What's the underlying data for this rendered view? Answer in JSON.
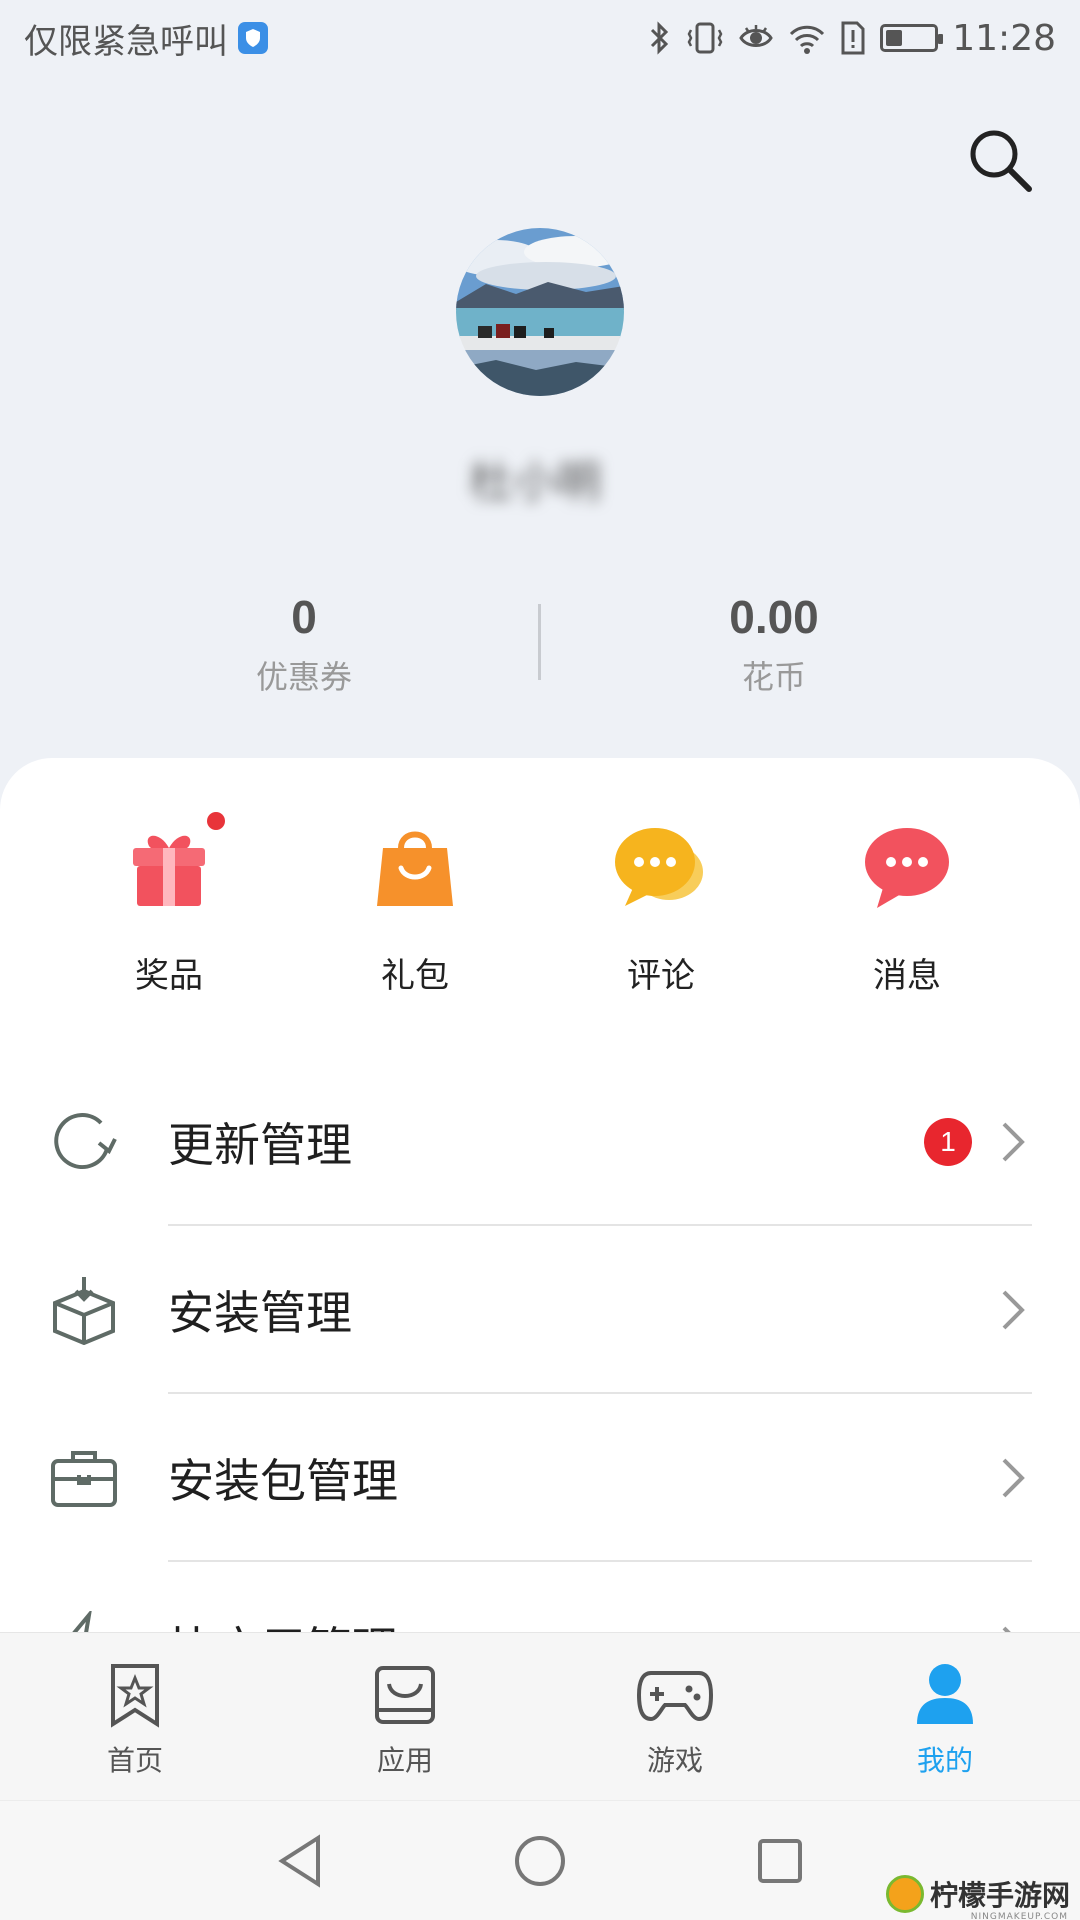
{
  "status_bar": {
    "carrier": "仅限紧急呼叫",
    "time": "11:28",
    "battery_level": 0.35
  },
  "header": {
    "search_icon": "search-icon"
  },
  "profile": {
    "avatar": "avatar-photo-lake",
    "username": "杜小明",
    "username_blurred": true
  },
  "stats": [
    {
      "value": "0",
      "label": "优惠券"
    },
    {
      "value": "0.00",
      "label": "花币"
    }
  ],
  "quick_actions": [
    {
      "label": "奖品",
      "icon": "gift-icon",
      "color": "#f2525e",
      "has_dot": true
    },
    {
      "label": "礼包",
      "icon": "shopping-bag-icon",
      "color": "#f6912b",
      "has_dot": false
    },
    {
      "label": "评论",
      "icon": "comment-icon",
      "color": "#f6b41e",
      "has_dot": false
    },
    {
      "label": "消息",
      "icon": "message-icon",
      "color": "#f2525e",
      "has_dot": false
    }
  ],
  "menu": [
    {
      "label": "更新管理",
      "icon": "refresh-icon",
      "badge": "1"
    },
    {
      "label": "安装管理",
      "icon": "install-box-icon",
      "badge": null
    },
    {
      "label": "安装包管理",
      "icon": "briefcase-icon",
      "badge": null
    },
    {
      "label": "快应用管理",
      "icon": "quick-app-icon",
      "badge": null
    }
  ],
  "bottom_nav": [
    {
      "label": "首页",
      "icon": "bookmark-star-icon",
      "active": false
    },
    {
      "label": "应用",
      "icon": "app-bag-icon",
      "active": false
    },
    {
      "label": "游戏",
      "icon": "gamepad-icon",
      "active": false
    },
    {
      "label": "我的",
      "icon": "person-icon",
      "active": true
    }
  ],
  "colors": {
    "accent": "#1ea1ef",
    "badge_red": "#e8262e",
    "background": "#eef1f6"
  },
  "watermark": {
    "text": "柠檬手游网",
    "sub": "NINGMAKEUP.COM"
  }
}
